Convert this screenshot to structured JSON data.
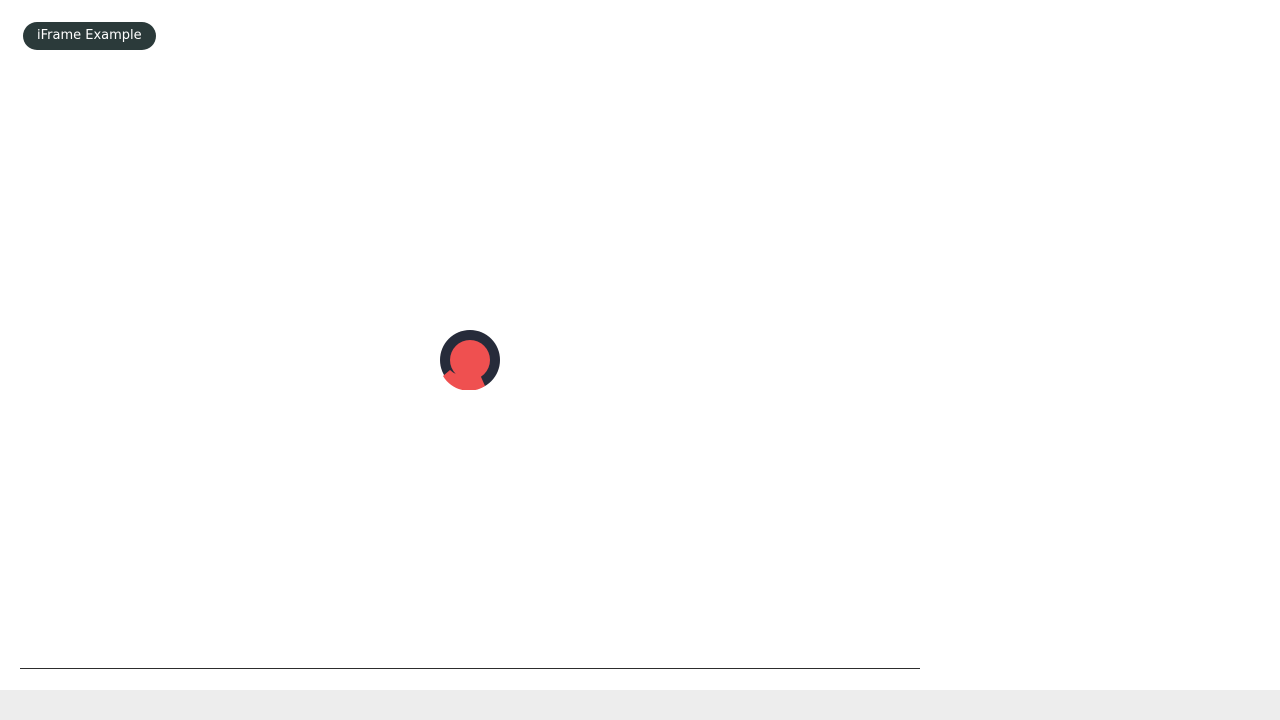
{
  "header": {
    "badge_label": "iFrame Example"
  },
  "loader": {
    "icon": "loading-spinner-icon",
    "colors": {
      "ring": "#262b3a",
      "core": "#ef5050"
    }
  },
  "colors": {
    "badge_bg": "#2b3a3a",
    "divider": "#2d2d2d",
    "footer_bg": "#ededed"
  }
}
